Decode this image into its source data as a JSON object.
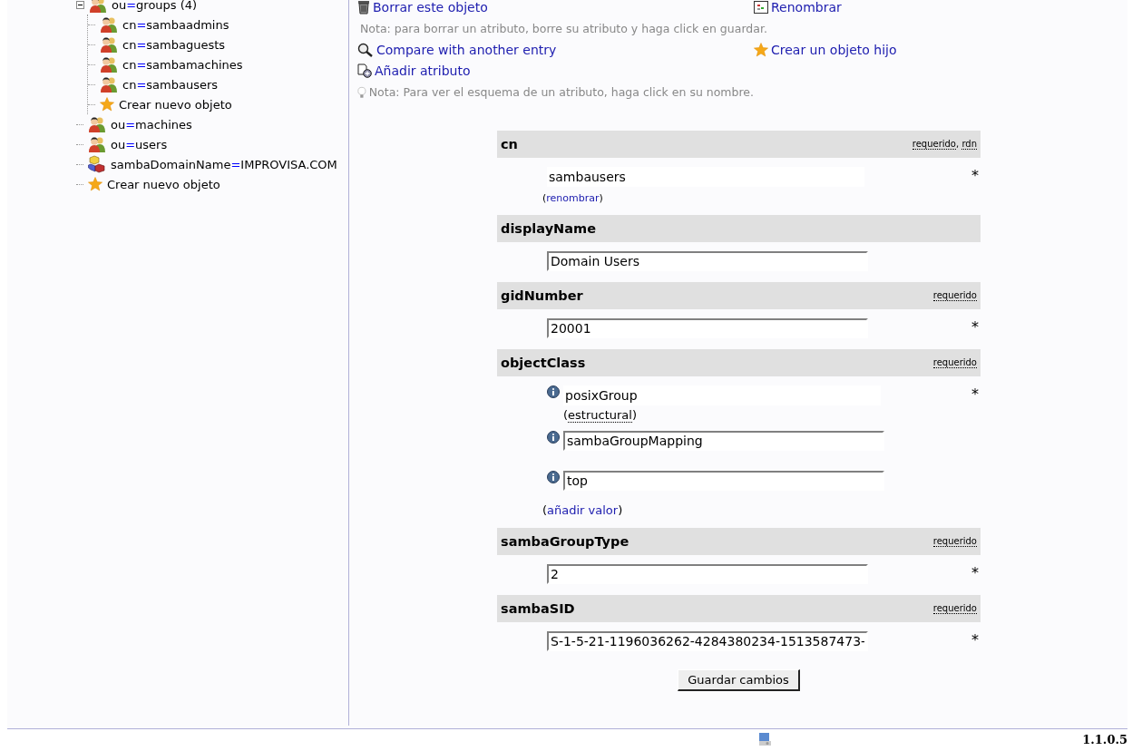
{
  "tree": [
    {
      "kind": "group",
      "name": "ou",
      "sep": "=",
      "value": "groups",
      "count": "(4)",
      "expanded": true,
      "children": [
        {
          "kind": "group",
          "name": "cn",
          "sep": "=",
          "value": "sambaadmins"
        },
        {
          "kind": "group",
          "name": "cn",
          "sep": "=",
          "value": "sambaguests"
        },
        {
          "kind": "group",
          "name": "cn",
          "sep": "=",
          "value": "sambamachines"
        },
        {
          "kind": "group",
          "name": "cn",
          "sep": "=",
          "value": "sambausers"
        },
        {
          "kind": "create",
          "value": "Crear nuevo objeto"
        }
      ]
    },
    {
      "kind": "group",
      "name": "ou",
      "sep": "=",
      "value": "machines"
    },
    {
      "kind": "group",
      "name": "ou",
      "sep": "=",
      "value": "users"
    },
    {
      "kind": "domain",
      "name": "sambaDomainName",
      "sep": "=",
      "value": "IMPROVISA.COM"
    },
    {
      "kind": "create",
      "value": "Crear nuevo objeto"
    }
  ],
  "actions": [
    {
      "kind": "links",
      "items": [
        {
          "kind": "delete",
          "text": "Borrar este objeto"
        },
        {
          "kind": "rename",
          "text": "Renombrar"
        }
      ]
    },
    {
      "kind": "note",
      "text": "Nota: para borrar un atributo, borre su atributo y haga click en guardar."
    },
    {
      "kind": "links",
      "items": [
        {
          "kind": "compare",
          "text": "Compare with another entry"
        },
        {
          "kind": "create-child",
          "text": "Crear un objeto hijo"
        }
      ]
    },
    {
      "kind": "links",
      "items": [
        {
          "kind": "add-attribute",
          "text": "Añadir atributo"
        }
      ]
    },
    {
      "kind": "note",
      "text": "Nota: Para ver el esquema de un atributo, haga click en su nombre."
    }
  ],
  "tag_separator": ",",
  "attributes": [
    {
      "name": "cn",
      "tags": [
        "requerido",
        "rdn"
      ],
      "values": [
        {
          "kind": "readonly",
          "text": "sambausers",
          "mark": "*"
        }
      ],
      "action": {
        "prefix": "(",
        "link": "renombrar",
        "suffix": ")"
      }
    },
    {
      "name": "displayName",
      "values": [
        {
          "kind": "input",
          "text": "Domain Users"
        }
      ]
    },
    {
      "name": "gidNumber",
      "tags": [
        "requerido"
      ],
      "values": [
        {
          "kind": "input",
          "text": "20001",
          "mark": "*"
        }
      ]
    },
    {
      "name": "objectClass",
      "tags": [
        "requerido"
      ],
      "values": [
        {
          "kind": "readonly",
          "info": true,
          "text": "posixGroup",
          "mark": "*",
          "note": {
            "prefix": "(",
            "term": "estructural",
            "suffix": ")"
          }
        },
        {
          "kind": "input",
          "info": true,
          "text": "sambaGroupMapping"
        },
        {
          "kind": "input",
          "info": true,
          "text": "top"
        }
      ],
      "action": {
        "prefix": "(",
        "link": "añadir valor",
        "suffix": ")"
      }
    },
    {
      "name": "sambaGroupType",
      "tags": [
        "requerido"
      ],
      "values": [
        {
          "kind": "input",
          "text": "2",
          "mark": "*"
        }
      ]
    },
    {
      "name": "sambaSID",
      "tags": [
        "requerido"
      ],
      "values": [
        {
          "kind": "input",
          "text": "S-1-5-21-1196036262-4284380234-1513587473-",
          "mark": "*"
        }
      ]
    }
  ],
  "save_button": "Guardar cambios",
  "footer": {
    "version": "1.1.0.5"
  }
}
